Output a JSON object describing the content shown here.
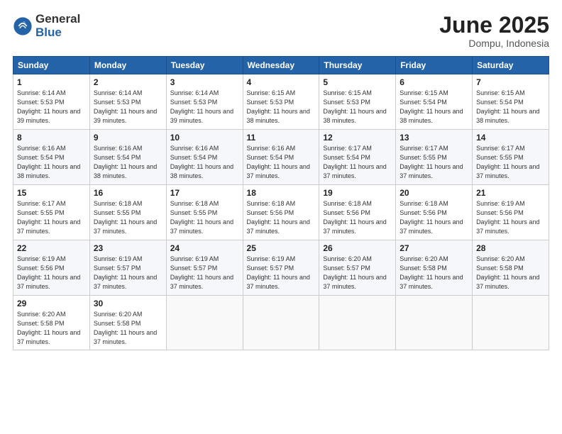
{
  "logo": {
    "general": "General",
    "blue": "Blue"
  },
  "title": "June 2025",
  "location": "Dompu, Indonesia",
  "days_header": [
    "Sunday",
    "Monday",
    "Tuesday",
    "Wednesday",
    "Thursday",
    "Friday",
    "Saturday"
  ],
  "weeks": [
    [
      {
        "day": "1",
        "sunrise": "6:14 AM",
        "sunset": "5:53 PM",
        "daylight": "11 hours and 39 minutes."
      },
      {
        "day": "2",
        "sunrise": "6:14 AM",
        "sunset": "5:53 PM",
        "daylight": "11 hours and 39 minutes."
      },
      {
        "day": "3",
        "sunrise": "6:14 AM",
        "sunset": "5:53 PM",
        "daylight": "11 hours and 39 minutes."
      },
      {
        "day": "4",
        "sunrise": "6:15 AM",
        "sunset": "5:53 PM",
        "daylight": "11 hours and 38 minutes."
      },
      {
        "day": "5",
        "sunrise": "6:15 AM",
        "sunset": "5:53 PM",
        "daylight": "11 hours and 38 minutes."
      },
      {
        "day": "6",
        "sunrise": "6:15 AM",
        "sunset": "5:54 PM",
        "daylight": "11 hours and 38 minutes."
      },
      {
        "day": "7",
        "sunrise": "6:15 AM",
        "sunset": "5:54 PM",
        "daylight": "11 hours and 38 minutes."
      }
    ],
    [
      {
        "day": "8",
        "sunrise": "6:16 AM",
        "sunset": "5:54 PM",
        "daylight": "11 hours and 38 minutes."
      },
      {
        "day": "9",
        "sunrise": "6:16 AM",
        "sunset": "5:54 PM",
        "daylight": "11 hours and 38 minutes."
      },
      {
        "day": "10",
        "sunrise": "6:16 AM",
        "sunset": "5:54 PM",
        "daylight": "11 hours and 38 minutes."
      },
      {
        "day": "11",
        "sunrise": "6:16 AM",
        "sunset": "5:54 PM",
        "daylight": "11 hours and 37 minutes."
      },
      {
        "day": "12",
        "sunrise": "6:17 AM",
        "sunset": "5:54 PM",
        "daylight": "11 hours and 37 minutes."
      },
      {
        "day": "13",
        "sunrise": "6:17 AM",
        "sunset": "5:55 PM",
        "daylight": "11 hours and 37 minutes."
      },
      {
        "day": "14",
        "sunrise": "6:17 AM",
        "sunset": "5:55 PM",
        "daylight": "11 hours and 37 minutes."
      }
    ],
    [
      {
        "day": "15",
        "sunrise": "6:17 AM",
        "sunset": "5:55 PM",
        "daylight": "11 hours and 37 minutes."
      },
      {
        "day": "16",
        "sunrise": "6:18 AM",
        "sunset": "5:55 PM",
        "daylight": "11 hours and 37 minutes."
      },
      {
        "day": "17",
        "sunrise": "6:18 AM",
        "sunset": "5:55 PM",
        "daylight": "11 hours and 37 minutes."
      },
      {
        "day": "18",
        "sunrise": "6:18 AM",
        "sunset": "5:56 PM",
        "daylight": "11 hours and 37 minutes."
      },
      {
        "day": "19",
        "sunrise": "6:18 AM",
        "sunset": "5:56 PM",
        "daylight": "11 hours and 37 minutes."
      },
      {
        "day": "20",
        "sunrise": "6:18 AM",
        "sunset": "5:56 PM",
        "daylight": "11 hours and 37 minutes."
      },
      {
        "day": "21",
        "sunrise": "6:19 AM",
        "sunset": "5:56 PM",
        "daylight": "11 hours and 37 minutes."
      }
    ],
    [
      {
        "day": "22",
        "sunrise": "6:19 AM",
        "sunset": "5:56 PM",
        "daylight": "11 hours and 37 minutes."
      },
      {
        "day": "23",
        "sunrise": "6:19 AM",
        "sunset": "5:57 PM",
        "daylight": "11 hours and 37 minutes."
      },
      {
        "day": "24",
        "sunrise": "6:19 AM",
        "sunset": "5:57 PM",
        "daylight": "11 hours and 37 minutes."
      },
      {
        "day": "25",
        "sunrise": "6:19 AM",
        "sunset": "5:57 PM",
        "daylight": "11 hours and 37 minutes."
      },
      {
        "day": "26",
        "sunrise": "6:20 AM",
        "sunset": "5:57 PM",
        "daylight": "11 hours and 37 minutes."
      },
      {
        "day": "27",
        "sunrise": "6:20 AM",
        "sunset": "5:58 PM",
        "daylight": "11 hours and 37 minutes."
      },
      {
        "day": "28",
        "sunrise": "6:20 AM",
        "sunset": "5:58 PM",
        "daylight": "11 hours and 37 minutes."
      }
    ],
    [
      {
        "day": "29",
        "sunrise": "6:20 AM",
        "sunset": "5:58 PM",
        "daylight": "11 hours and 37 minutes."
      },
      {
        "day": "30",
        "sunrise": "6:20 AM",
        "sunset": "5:58 PM",
        "daylight": "11 hours and 37 minutes."
      },
      null,
      null,
      null,
      null,
      null
    ]
  ]
}
